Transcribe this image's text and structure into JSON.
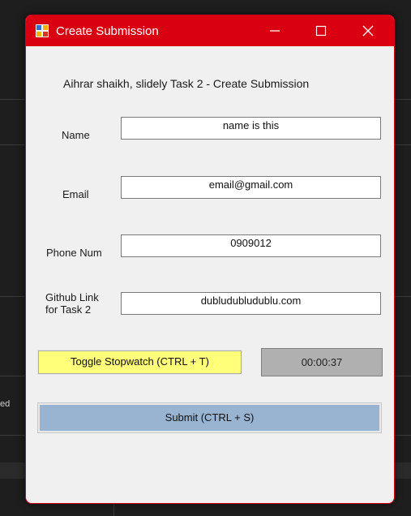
{
  "background_app": {
    "partial_text": "ed"
  },
  "window": {
    "title": "Create Submission",
    "controls": {
      "minimize_icon": "minimize-icon",
      "maximize_icon": "maximize-icon",
      "close_icon": "close-icon"
    },
    "accent_color": "#d90012"
  },
  "form": {
    "header": "Aihrar shaikh, slidely Task 2 - Create Submission",
    "name": {
      "label": "Name",
      "value": "name is this"
    },
    "email": {
      "label": "Email",
      "value": "email@gmail.com"
    },
    "phone": {
      "label": "Phone Num",
      "value": "0909012"
    },
    "github": {
      "label_line1": "Github Link",
      "label_line2": "for Task 2",
      "value": "dubludubludublu.com"
    },
    "stopwatch_button": "Toggle Stopwatch (CTRL + T)",
    "timer": "00:00:37",
    "submit_button": "Submit (CTRL + S)"
  }
}
